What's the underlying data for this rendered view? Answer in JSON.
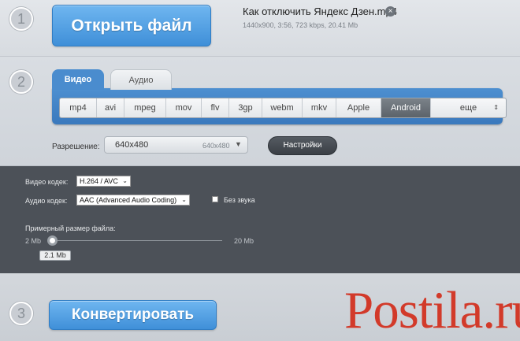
{
  "steps": [
    "1",
    "2",
    "3"
  ],
  "file": {
    "open_button": "Открыть файл",
    "name": "Как отключить Яндекс Дзен.mp4",
    "close_icon": "close-icon",
    "meta": "1440x900, 3:56, 723 kbps, 20.41 Mb"
  },
  "tabs": [
    {
      "label": "Видео",
      "active": true
    },
    {
      "label": "Аудио",
      "active": false
    }
  ],
  "formats": {
    "items": [
      "mp4",
      "avi",
      "mpeg",
      "mov",
      "flv",
      "3gp",
      "webm",
      "mkv",
      "Apple",
      "Android",
      "еще"
    ],
    "active": "Android",
    "more_icon": "up-down-arrows-icon"
  },
  "resolution": {
    "label": "Разрешение:",
    "value": "640x480",
    "value_hint": "640x480"
  },
  "settings_button": "Настройки",
  "codecs": {
    "video_label": "Видео кодек:",
    "video_value": "H.264 / AVC",
    "audio_label": "Аудио кодек:",
    "audio_value": "AAC (Advanced Audio Coding)",
    "no_sound_label": "Без звука",
    "no_sound_checked": false
  },
  "file_size": {
    "label": "Примерный размер файла:",
    "min": "2 Mb",
    "max": "20 Mb",
    "current": "2.1 Mb"
  },
  "convert_button": "Конвертировать",
  "watermark": "Postila.ru",
  "colors": {
    "accent_blue": "#4a8cce",
    "dark_panel": "#4c5158",
    "watermark_red": "#d23a2a"
  }
}
